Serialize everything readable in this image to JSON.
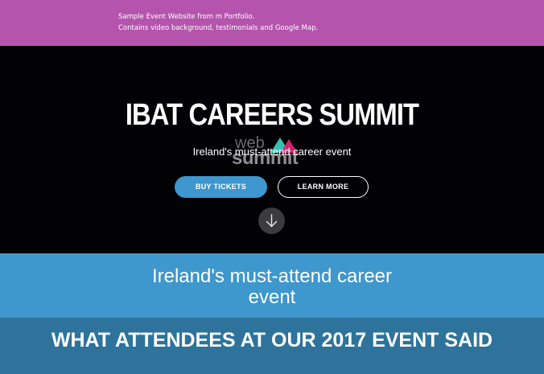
{
  "banner": {
    "line1": "Sample Event Website from m Portfolio.",
    "line2": "Contains video background, testimonials and Google Map."
  },
  "hero": {
    "title": "IBAT CAREERS SUMMIT",
    "subtitle": "Ireland's must-attend career event",
    "logo": {
      "word1": "web",
      "word2": "summit"
    },
    "buttons": {
      "buy_label": "BUY TICKETS",
      "learn_label": "LEARN MORE"
    },
    "scroll_icon": "arrow-down-icon"
  },
  "tagline": {
    "text": "Ireland's must-attend career event"
  },
  "testimonials": {
    "heading": "WHAT ATTENDEES AT OUR 2017 EVENT SAID"
  },
  "colors": {
    "banner_bg": "#b554ad",
    "hero_bg": "#020104",
    "accent_blue": "#3e97cd",
    "testimonials_bg": "#2d739b",
    "logo_teal": "#34c2b4",
    "logo_pink": "#e0287a"
  }
}
